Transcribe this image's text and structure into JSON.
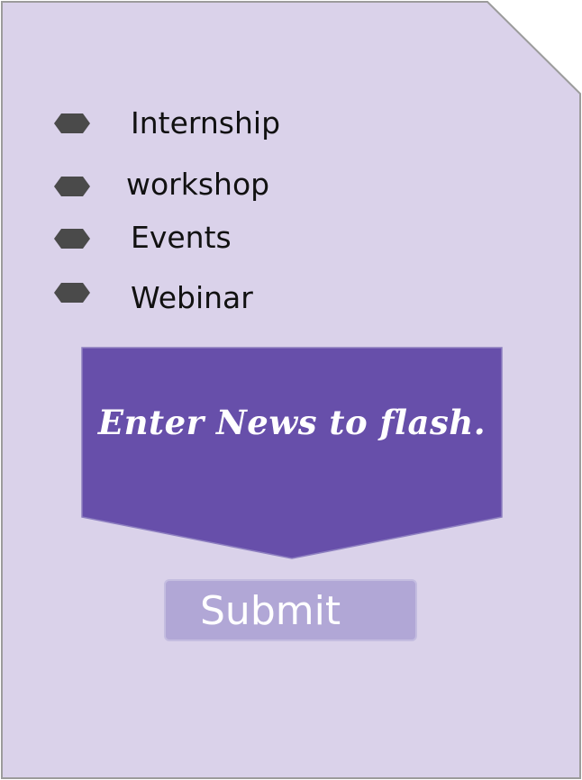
{
  "colors": {
    "card_fill": "#dad2ea",
    "card_border": "#9c9c9c",
    "bullet": "#4a4a4a",
    "banner_fill": "#674faa",
    "banner_text": "#ffffff",
    "button_fill": "#b1a7d6",
    "button_text": "#ffffff"
  },
  "menu": {
    "items": [
      {
        "label": "Internship",
        "icon": "hexagon-bullet-icon"
      },
      {
        "label": "workshop",
        "icon": "hexagon-bullet-icon"
      },
      {
        "label": "Events",
        "icon": "hexagon-bullet-icon"
      },
      {
        "label": "Webinar",
        "icon": "hexagon-bullet-icon"
      }
    ]
  },
  "banner": {
    "text": "Enter News to flash."
  },
  "form": {
    "submit_label": "Submit"
  }
}
